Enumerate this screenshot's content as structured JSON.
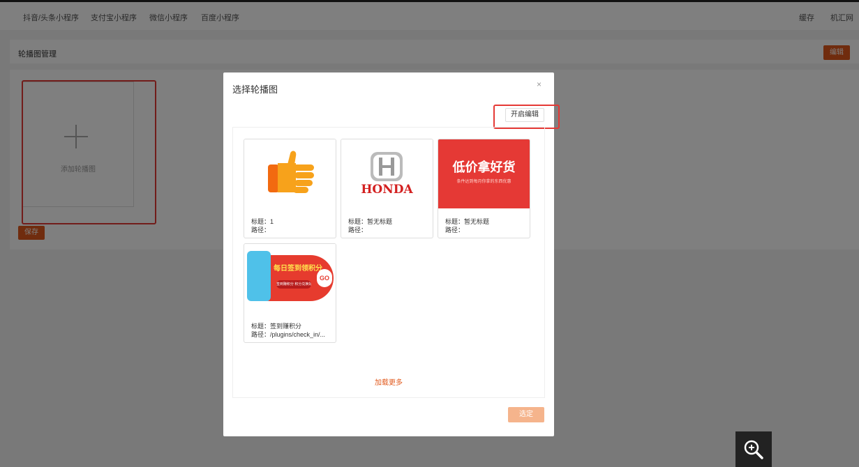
{
  "topnav": {
    "items": [
      "抖音/头条小程序",
      "支付宝小程序",
      "微信小程序",
      "百度小程序"
    ],
    "cache": "缓存",
    "user": "机汇网"
  },
  "panel": {
    "title": "轮播图管理",
    "edit_label": "编辑",
    "add_label": "添加轮播图",
    "save_label": "保存"
  },
  "modal": {
    "title": "选择轮播图",
    "close": "×",
    "toggle_edit": "开启编辑",
    "load_more": "加载更多",
    "confirm": "选定",
    "cards": [
      {
        "title": "标题：1",
        "path": "路径："
      },
      {
        "title": "标题：暂无标题",
        "path": "路径：",
        "logo_text": "HONDA"
      },
      {
        "title": "标题：暂无标题",
        "path": "路径：",
        "banner_text": "低价拿好货",
        "banner_sub": "条件达到每月你拿的东西优惠"
      },
      {
        "title": "标题：签到赚积分",
        "path": "路径：/plugins/check_in/...",
        "banner_text": "每日签到领积分",
        "banner_sub": "签到赚积分 积分兑换好礼",
        "badge": "GO"
      }
    ]
  },
  "colors": {
    "accent": "#e1591c",
    "highlight": "#e53935",
    "confirm_disabled": "#f5b48c"
  }
}
